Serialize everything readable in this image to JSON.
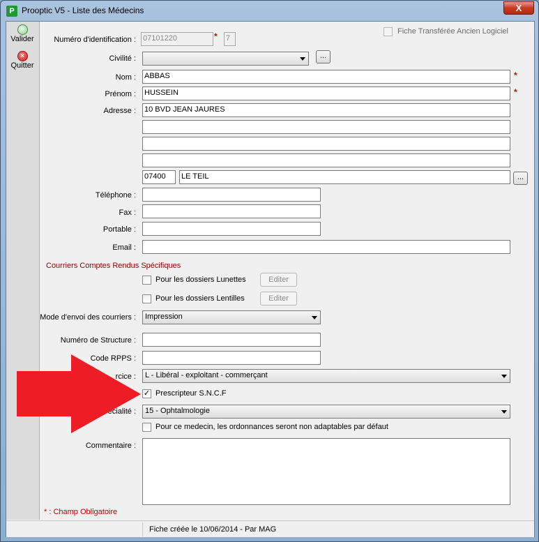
{
  "window": {
    "title": "Prooptic V5 - Liste des Médecins",
    "close_label": "X",
    "app_icon_letter": "P"
  },
  "sidebar": {
    "valider_label": "Valider",
    "quitter_label": "Quitter",
    "quit_icon_glyph": "×"
  },
  "form": {
    "id_label": "Numéro d'identification :",
    "id_value": "07101220",
    "id_suffix": "7",
    "required_mark": "*",
    "transfer_label": "Fiche Transférée Ancien Logiciel",
    "civilite_label": "Civilité :",
    "civilite_value": "",
    "dots": "...",
    "nom_label": "Nom :",
    "nom_value": "ABBAS",
    "prenom_label": "Prénom :",
    "prenom_value": "HUSSEIN",
    "adresse_label": "Adresse :",
    "adresse_1": "10 BVD JEAN JAURES",
    "adresse_2": "",
    "adresse_3": "",
    "adresse_4": "",
    "cp_value": "07400",
    "ville_value": "LE TEIL",
    "telephone_label": "Téléphone :",
    "telephone_value": "",
    "fax_label": "Fax :",
    "fax_value": "",
    "portable_label": "Portable :",
    "portable_value": "",
    "email_label": "Email :",
    "email_value": "",
    "courriers_section": "Courriers Comptes Rendus Spécifiques",
    "lunettes_label": "Pour les dossiers Lunettes",
    "lentilles_label": "Pour les dossiers Lentilles",
    "editer_label": "Editer",
    "mode_envoi_label": "Mode d'envoi des courriers :",
    "mode_envoi_value": "Impression",
    "structure_label": "Numéro de Structure :",
    "structure_value": "",
    "rpps_label": "Code RPPS :",
    "rpps_value": "",
    "exercice_label_visible": "rcice :",
    "exercice_value": "L - Libéral - exploitant - commerçant",
    "sncf_label": "Prescripteur S.N.C.F",
    "sncf_checked": true,
    "check_glyph": "✓",
    "specialite_label_visible": "écialité :",
    "specialite_value": "15 - Ophtalmologie",
    "non_adaptable_label": "Pour ce medecin, les ordonnances seront non adaptables par défaut",
    "commentaire_label": "Commentaire :",
    "commentaire_value": "",
    "champ_obligatoire": "* : Champ Obligatoire"
  },
  "status": {
    "text": "Fiche créée le 10/06/2014 - Par MAG"
  },
  "colors": {
    "arrow": "#ee1c25",
    "required": "#e00000",
    "section": "#8b0000"
  }
}
